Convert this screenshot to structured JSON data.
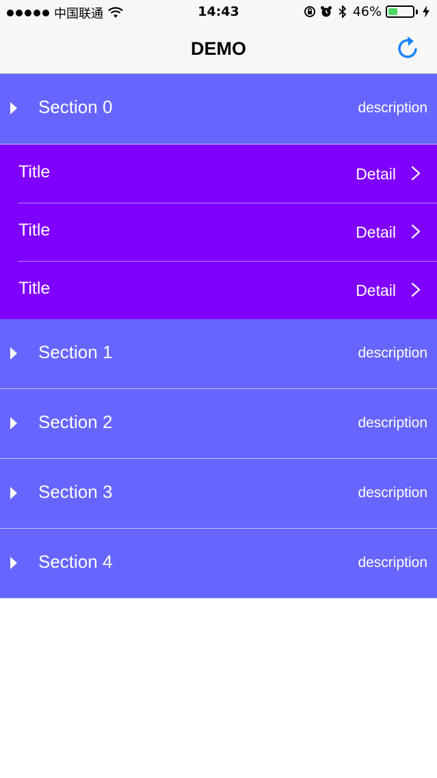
{
  "status_bar": {
    "carrier": "中国联通",
    "time": "14:43",
    "battery_percent": "46%",
    "battery_level": 0.46
  },
  "nav": {
    "title": "DEMO",
    "refresh_icon": "refresh-icon"
  },
  "colors": {
    "section_bg": "#6666ff",
    "row_bg": "#8000ff",
    "accent": "#1a82fb",
    "text": "#ffffff"
  },
  "sections": [
    {
      "title": "Section 0",
      "description": "description",
      "expanded": true,
      "rows": [
        {
          "title": "Title",
          "detail": "Detail"
        },
        {
          "title": "Title",
          "detail": "Detail"
        },
        {
          "title": "Title",
          "detail": "Detail"
        }
      ]
    },
    {
      "title": "Section 1",
      "description": "description",
      "expanded": false
    },
    {
      "title": "Section 2",
      "description": "description",
      "expanded": false
    },
    {
      "title": "Section 3",
      "description": "description",
      "expanded": false
    },
    {
      "title": "Section 4",
      "description": "description",
      "expanded": false
    }
  ]
}
